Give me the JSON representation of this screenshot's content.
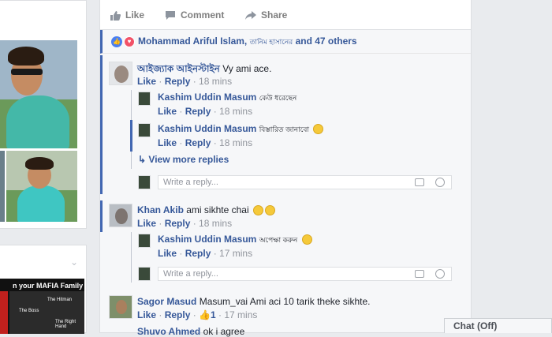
{
  "post": {
    "actions": {
      "like": "Like",
      "comment": "Comment",
      "share": "Share"
    },
    "reactions": {
      "name": "Mohammad Ariful Islam,",
      "small": "তানিম হাসানের",
      "others": "and 47 others"
    },
    "comments": [
      {
        "author": "আইজ্যাক আইনস্টাইন",
        "text": "Vy ami ace.",
        "like": "Like",
        "reply": "Reply",
        "time": "18 mins",
        "replies": [
          {
            "author": "Kashim Uddin Masum",
            "text": "কেউ ধরেছেন",
            "like": "Like",
            "reply": "Reply",
            "time": "18 mins"
          },
          {
            "author": "Kashim Uddin Masum",
            "text": "বিস্তারিত জানাবো",
            "like": "Like",
            "reply": "Reply",
            "time": "18 mins"
          }
        ],
        "view_more": "View more replies",
        "reply_placeholder": "Write a reply..."
      },
      {
        "author": "Khan Akib",
        "text": "ami sikhte chai",
        "like": "Like",
        "reply": "Reply",
        "time": "18 mins",
        "replies": [
          {
            "author": "Kashim Uddin Masum",
            "text": "অপেক্ষা করুন",
            "like": "Like",
            "reply": "Reply",
            "time": "17 mins"
          }
        ],
        "reply_placeholder": "Write a reply..."
      },
      {
        "author": "Sagor Masud",
        "text": "Masum_vai Ami aci 10 tarik theke sikhte.",
        "like": "Like",
        "reply": "Reply",
        "likes_count": "1",
        "time": "17 mins"
      },
      {
        "author": "Shuvo Ahmed",
        "text": "ok i agree"
      }
    ]
  },
  "sidebar": {
    "mafia_caption": "n your MAFIA Family",
    "labels": [
      "The Hitman",
      "The Boss",
      "The Right Hand"
    ]
  },
  "chat": {
    "label": "Chat (Off)"
  }
}
